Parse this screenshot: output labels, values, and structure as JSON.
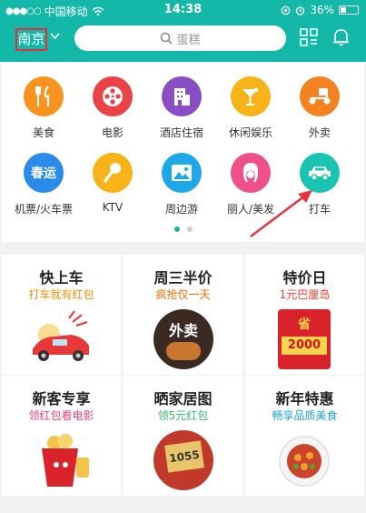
{
  "status_bar": {
    "carrier": "中国移动",
    "time": "14:38",
    "battery": "36%"
  },
  "header": {
    "city": "南京",
    "search_placeholder": "蛋糕"
  },
  "categories": [
    {
      "label": "美食",
      "icon": "fork-knife-icon",
      "color": "#f7931e"
    },
    {
      "label": "电影",
      "icon": "film-reel-icon",
      "color": "#e94345"
    },
    {
      "label": "酒店住宿",
      "icon": "hotel-icon",
      "color": "#8a4ec4"
    },
    {
      "label": "休闲娱乐",
      "icon": "cocktail-icon",
      "color": "#f8b318"
    },
    {
      "label": "外卖",
      "icon": "scooter-icon",
      "color": "#f58220"
    },
    {
      "label": "机票/火车票",
      "icon": "chunyun-icon",
      "badge_text": "春运",
      "color": "#2b8be8"
    },
    {
      "label": "KTV",
      "icon": "microphone-icon",
      "color": "#f8b318"
    },
    {
      "label": "周边游",
      "icon": "landscape-icon",
      "color": "#1ea8e8"
    },
    {
      "label": "丽人/美发",
      "icon": "woman-face-icon",
      "color": "#f0508a"
    },
    {
      "label": "打车",
      "icon": "car-icon",
      "color": "#19c5b2"
    }
  ],
  "promos": [
    {
      "title": "快上车",
      "subtitle": "打车就有红包",
      "subtitle_color": "#ff8a00"
    },
    {
      "title": "周三半价",
      "subtitle": "疯抢仅一天",
      "subtitle_color": "#ff6a00",
      "image_text": "外卖"
    },
    {
      "title": "特价日",
      "subtitle": "1元巴厘岛",
      "subtitle_color": "#ff3b30",
      "image_text": "省",
      "image_number": "2000"
    },
    {
      "title": "新客专享",
      "subtitle": "领红包看电影",
      "subtitle_color": "#e8437a"
    },
    {
      "title": "晒家居图",
      "subtitle": "领5元红包",
      "subtitle_color": "#3cb371",
      "image_number": "1055"
    },
    {
      "title": "新年特惠",
      "subtitle": "畅享品质美食",
      "subtitle_color": "#1fa4e0"
    }
  ],
  "colors": {
    "primary": "#13b8a8",
    "annotation": "#e8323b"
  }
}
